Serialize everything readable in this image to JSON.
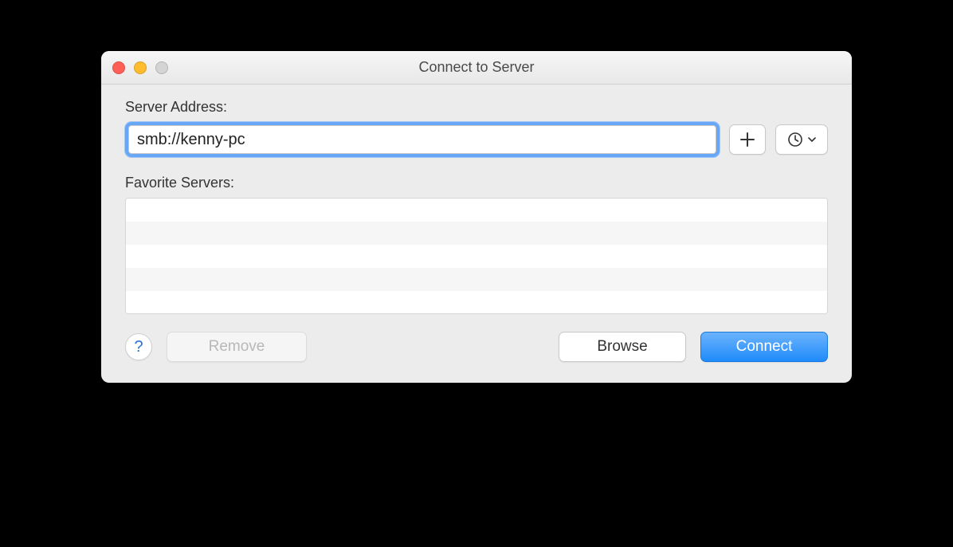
{
  "window": {
    "title": "Connect to Server"
  },
  "labels": {
    "server_address": "Server Address:",
    "favorite_servers": "Favorite Servers:"
  },
  "server_input": {
    "value": "smb://kenny-pc",
    "placeholder": ""
  },
  "favorites": [],
  "buttons": {
    "remove": "Remove",
    "browse": "Browse",
    "connect": "Connect",
    "help": "?"
  },
  "icons": {
    "add": "plus-icon",
    "history": "clock-icon",
    "dropdown": "chevron-down-icon"
  }
}
